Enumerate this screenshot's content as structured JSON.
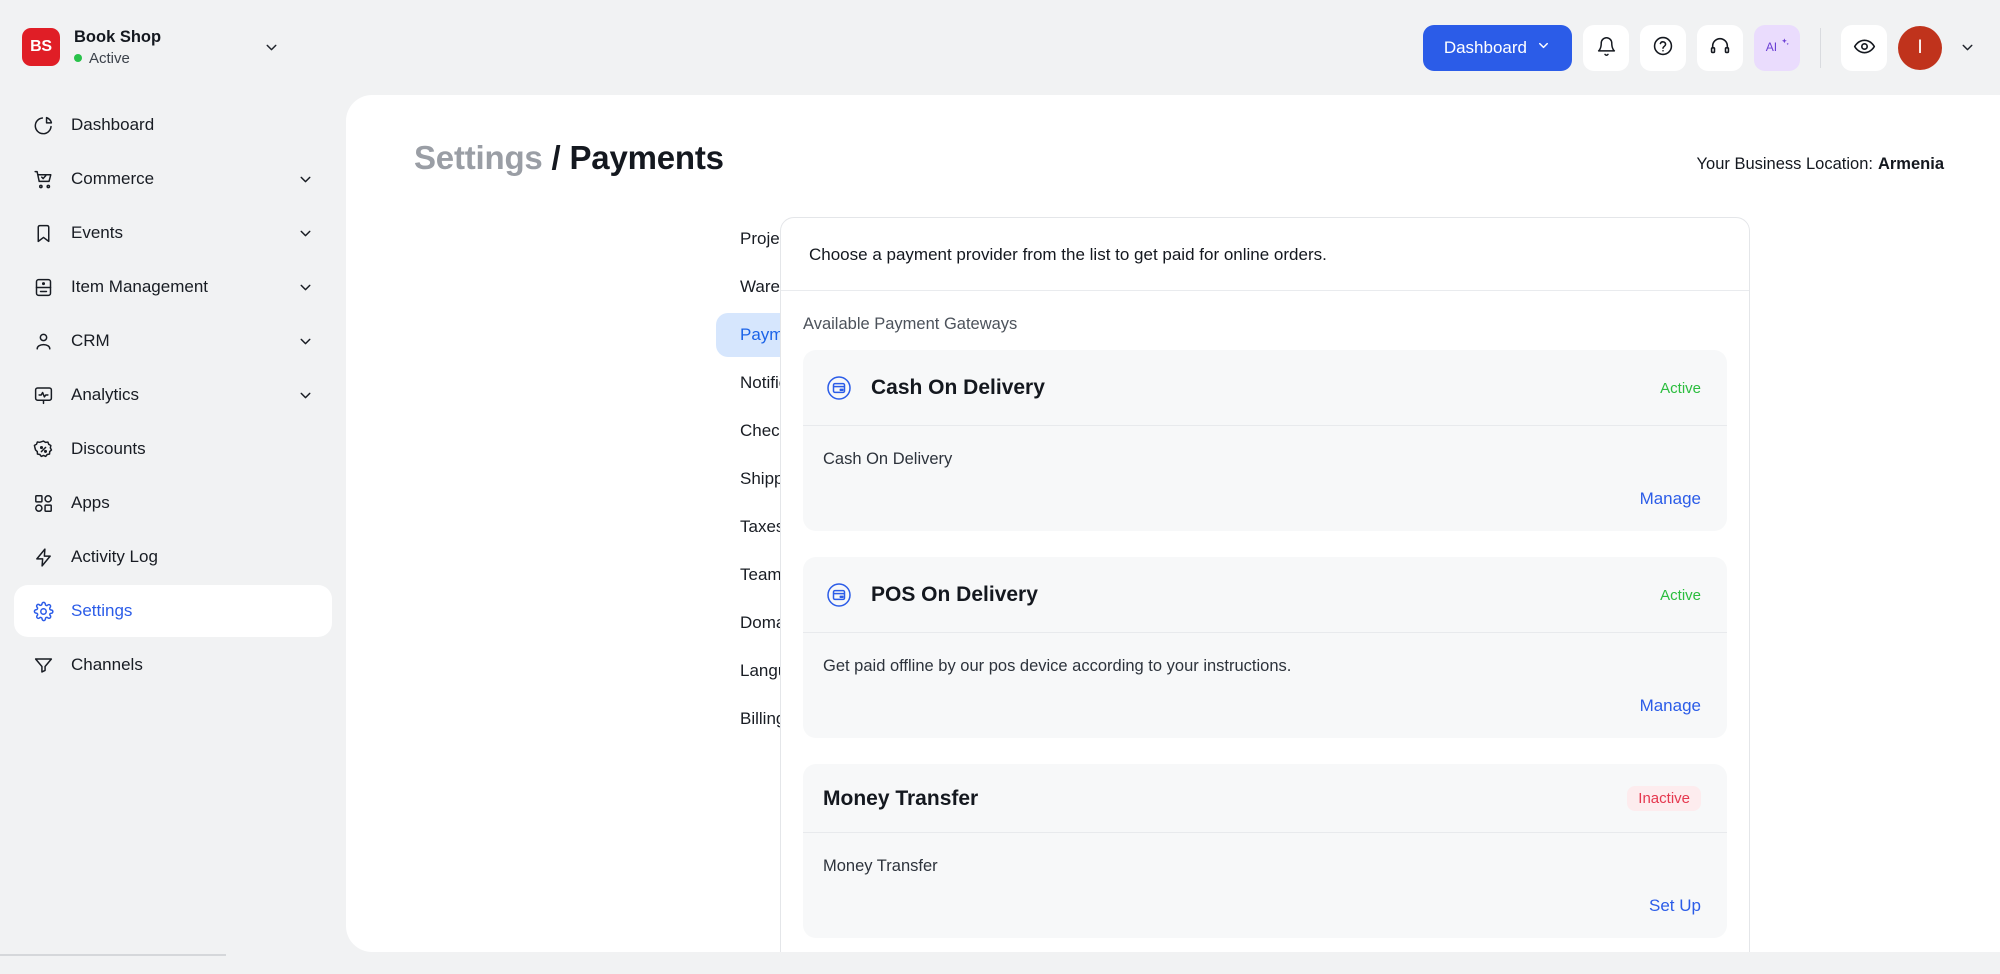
{
  "brand": {
    "logo_text": "BS",
    "name": "Book Shop",
    "status": "Active",
    "logo_color": "#e01e26",
    "status_color": "#29c24a"
  },
  "topbar": {
    "dashboard_button": "Dashboard",
    "icons": [
      {
        "name": "bell-icon",
        "label": "Notifications"
      },
      {
        "name": "question-mark-icon",
        "label": "Help"
      },
      {
        "name": "headset-icon",
        "label": "Support"
      },
      {
        "name": "ai-sparkle-icon",
        "label": "AI"
      },
      {
        "name": "eye-icon",
        "label": "Preview"
      }
    ],
    "avatar_initial": "I",
    "accent_color": "#2b5ce8"
  },
  "sidebar": {
    "items": [
      {
        "label": "Dashboard",
        "icon": "pie-chart-icon",
        "expandable": false,
        "active": false
      },
      {
        "label": "Commerce",
        "icon": "shopping-cart-icon",
        "expandable": true,
        "active": false
      },
      {
        "label": "Events",
        "icon": "bookmark-icon",
        "expandable": true,
        "active": false
      },
      {
        "label": "Item Management",
        "icon": "database-icon",
        "expandable": true,
        "active": false
      },
      {
        "label": "CRM",
        "icon": "user-icon",
        "expandable": true,
        "active": false
      },
      {
        "label": "Analytics",
        "icon": "monitor-pulse-icon",
        "expandable": true,
        "active": false
      },
      {
        "label": "Discounts",
        "icon": "percent-badge-icon",
        "expandable": false,
        "active": false
      },
      {
        "label": "Apps",
        "icon": "grid-apps-icon",
        "expandable": false,
        "active": false
      },
      {
        "label": "Activity Log",
        "icon": "lightning-bolt-icon",
        "expandable": false,
        "active": false
      },
      {
        "label": "Settings",
        "icon": "gear-icon",
        "expandable": false,
        "active": true
      },
      {
        "label": "Channels",
        "icon": "funnel-icon",
        "expandable": false,
        "active": false
      }
    ]
  },
  "header": {
    "breadcrumb_parent": "Settings",
    "breadcrumb_separator": "/",
    "breadcrumb_current": "Payments",
    "business_location_label": "Your Business Location:",
    "business_location_value": "Armenia"
  },
  "settings_nav": {
    "items": [
      {
        "label": "Project Details",
        "active": false
      },
      {
        "label": "Warehouses",
        "active": false
      },
      {
        "label": "Payments",
        "active": true
      },
      {
        "label": "Notifications",
        "active": false
      },
      {
        "label": "Checkouts",
        "active": false
      },
      {
        "label": "Shipping & Delivery",
        "active": false
      },
      {
        "label": "Taxes",
        "active": false
      },
      {
        "label": "Team",
        "active": false
      },
      {
        "label": "Domains",
        "active": false
      },
      {
        "label": "Languages",
        "active": false
      },
      {
        "label": "Billing",
        "active": false
      }
    ]
  },
  "payments": {
    "intro": "Choose a payment provider from the list to get paid for online orders.",
    "section_label": "Available Payment Gateways",
    "gateways": [
      {
        "name": "Cash On Delivery",
        "icon": "payment-card-icon",
        "has_icon": true,
        "status": "Active",
        "status_type": "active",
        "description": "Cash On Delivery",
        "action": "Manage"
      },
      {
        "name": "POS On Delivery",
        "icon": "payment-card-icon",
        "has_icon": true,
        "status": "Active",
        "status_type": "active",
        "description": "Get paid offline by our pos device according to your instructions.",
        "action": "Manage"
      },
      {
        "name": "Money Transfer",
        "icon": "",
        "has_icon": false,
        "status": "Inactive",
        "status_type": "inactive",
        "description": "Money Transfer",
        "action": "Set Up"
      }
    ]
  }
}
